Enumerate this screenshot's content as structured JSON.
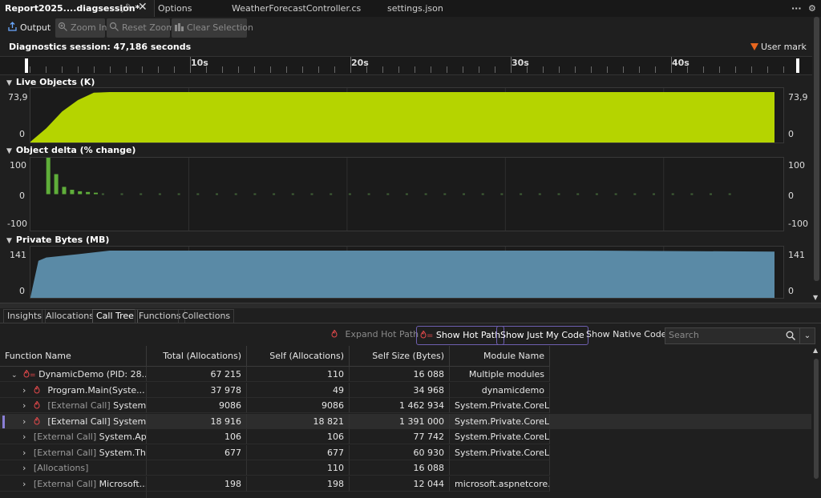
{
  "tabs": {
    "active": "Report2025....diagsession*",
    "items": [
      "Options",
      "WeatherForecastController.cs",
      "settings.json"
    ],
    "more_label": "···"
  },
  "toolbar": {
    "output_label": "Output",
    "zoom_in_label": "Zoom In",
    "reset_zoom_label": "Reset Zoom",
    "clear_selection_label": "Clear Selection"
  },
  "session": {
    "label": "Diagnostics session: 47,186 seconds",
    "user_mark_label": "User mark"
  },
  "ruler": {
    "labels": [
      "10s",
      "20s",
      "30s",
      "40s"
    ]
  },
  "charts": {
    "live_objects": {
      "title": "Live Objects (K)",
      "y_max": "73,9",
      "y_min": "0",
      "color": "#b5d400"
    },
    "object_delta": {
      "title": "Object delta (% change)",
      "y_max": "100",
      "y_mid": "0",
      "y_min": "-100",
      "color": "#5fae3a"
    },
    "private_bytes": {
      "title": "Private Bytes (MB)",
      "y_max": "141",
      "y_min": "0",
      "color": "#5a8aa6"
    }
  },
  "chart_data": [
    {
      "type": "area",
      "title": "Live Objects (K)",
      "x": [
        0,
        1,
        2,
        3,
        4,
        5,
        12,
        47
      ],
      "values": [
        0,
        20,
        45,
        62,
        73,
        73.9,
        73.9,
        73.9
      ],
      "ylim": [
        0,
        73.9
      ]
    },
    {
      "type": "bar",
      "title": "Object delta (% change)",
      "x": [
        1,
        1.5,
        2,
        2.5,
        3,
        3.5,
        4
      ],
      "values": [
        100,
        55,
        20,
        12,
        8,
        6,
        4
      ],
      "ylim": [
        -100,
        100
      ]
    },
    {
      "type": "area",
      "title": "Private Bytes (MB)",
      "x": [
        0,
        0.5,
        1,
        3,
        5,
        35,
        47
      ],
      "values": [
        0,
        110,
        120,
        130,
        141,
        141,
        138
      ],
      "ylim": [
        0,
        141
      ]
    }
  ],
  "subtabs": [
    "Insights",
    "Allocations",
    "Call Tree",
    "Functions",
    "Collections"
  ],
  "calltree_toolbar": {
    "expand_hot_path": "Expand Hot Path",
    "show_hot_path": "Show Hot Path",
    "show_just_my_code": "Show Just My Code",
    "show_native_code": "Show Native Code",
    "search_placeholder": "Search"
  },
  "table": {
    "headers": [
      "Function Name",
      "Total (Allocations)",
      "Self (Allocations)",
      "Self Size (Bytes)",
      "Module Name"
    ],
    "rows": [
      {
        "name": "DynamicDemo (PID: 28...",
        "total": "67 215",
        "self": "110",
        "size": "16 088",
        "module": "Multiple modules"
      },
      {
        "name": "Program.Main(Syste...",
        "total": "37 978",
        "self": "49",
        "size": "34 968",
        "module": "dynamicdemo"
      },
      {
        "name_grey": "[External Call]",
        "name": "System....",
        "total": "9086",
        "self": "9086",
        "size": "1 462 934",
        "module": "System.Private.CoreLi..."
      },
      {
        "name_grey": "[External Call]",
        "name": "System....",
        "total": "18 916",
        "self": "18 821",
        "size": "1 391 000",
        "module": "System.Private.CoreLi..."
      },
      {
        "name_grey": "[External Call]",
        "name": "System.Ap...",
        "total": "106",
        "self": "106",
        "size": "77 742",
        "module": "System.Private.CoreLi..."
      },
      {
        "name_grey": "[External Call]",
        "name": "System.Thr...",
        "total": "677",
        "self": "677",
        "size": "60 930",
        "module": "System.Private.CoreLi..."
      },
      {
        "name_grey": "[Allocations]",
        "name": "",
        "total": "",
        "self": "110",
        "size": "16 088",
        "module": ""
      },
      {
        "name_grey": "[External Call]",
        "name": "Microsoft....",
        "total": "198",
        "self": "198",
        "size": "12 044",
        "module": "microsoft.aspnetcore...."
      }
    ]
  }
}
